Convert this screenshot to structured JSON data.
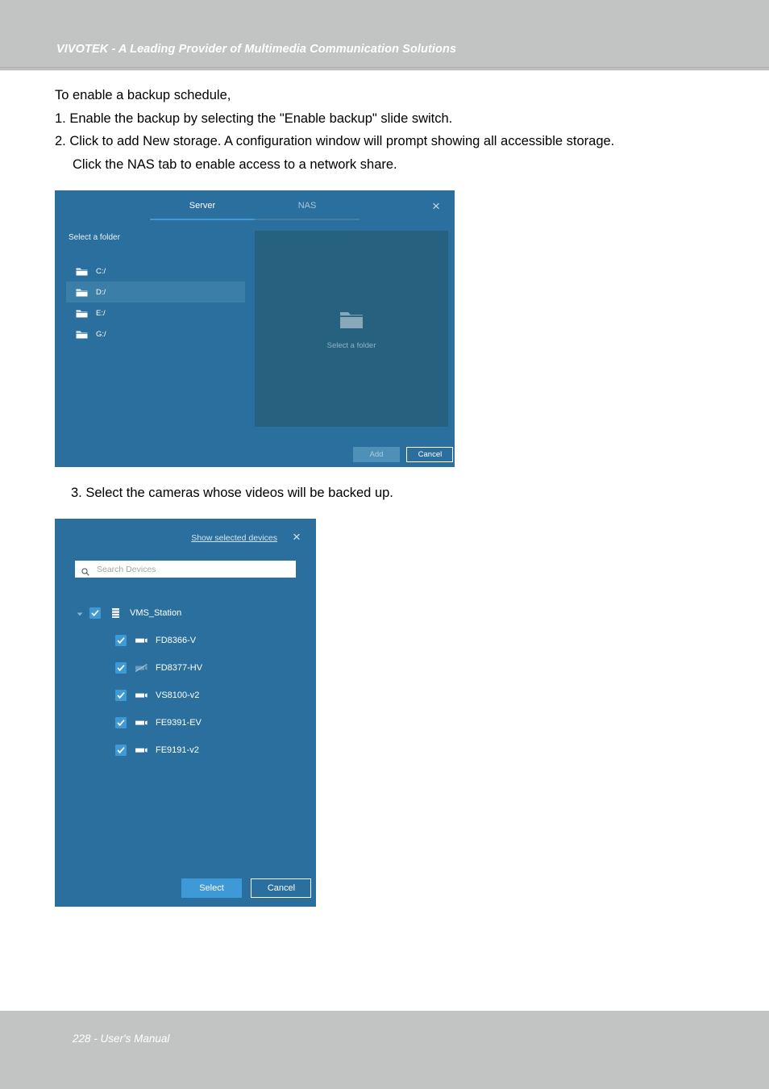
{
  "header": {
    "title": "VIVOTEK - A Leading Provider of Multimedia Communication Solutions"
  },
  "footer": {
    "text": "228 - User's Manual"
  },
  "body": {
    "intro": "To enable a backup schedule,",
    "step1": "1. Enable the backup by selecting the \"Enable backup\" slide switch.",
    "step2_line1": "2. Click to add New storage. A configuration window will prompt showing all accessible storage.",
    "step2_line2": "Click the NAS tab to enable access to a network share.",
    "step3": "3. Select the cameras whose videos will be backed up."
  },
  "storage_dialog": {
    "tabs": [
      {
        "label": "Server",
        "active": true
      },
      {
        "label": "NAS",
        "active": false
      }
    ],
    "close_label": "×",
    "folder_heading": "Select a folder",
    "folders": [
      {
        "label": "C:/",
        "selected": false
      },
      {
        "label": "D:/",
        "selected": true
      },
      {
        "label": "E:/",
        "selected": false
      },
      {
        "label": "G:/",
        "selected": false
      }
    ],
    "preview_placeholder": "Select a folder",
    "buttons": {
      "add": "Add",
      "cancel": "Cancel"
    }
  },
  "device_dialog": {
    "show_selected_link": "Show selected devices",
    "close_label": "×",
    "search": {
      "value": "",
      "placeholder": "Search Devices"
    },
    "tree": {
      "root": {
        "label": "VMS_Station",
        "checked": true,
        "expanded": true
      },
      "children": [
        {
          "label": "FD8366-V",
          "checked": true,
          "state": "online"
        },
        {
          "label": "FD8377-HV",
          "checked": true,
          "state": "offline"
        },
        {
          "label": "VS8100-v2",
          "checked": true,
          "state": "online"
        },
        {
          "label": "FE9391-EV",
          "checked": true,
          "state": "online"
        },
        {
          "label": "FE9191-v2",
          "checked": true,
          "state": "online"
        }
      ]
    },
    "buttons": {
      "select": "Select",
      "cancel": "Cancel"
    }
  },
  "colors": {
    "dialog_blue": "#2a6f9e",
    "panel_blue": "#26617f",
    "accent_blue": "#3e9ad6",
    "band_gray": "#c2c3c3",
    "row_highlight": "#3b7fa9"
  }
}
